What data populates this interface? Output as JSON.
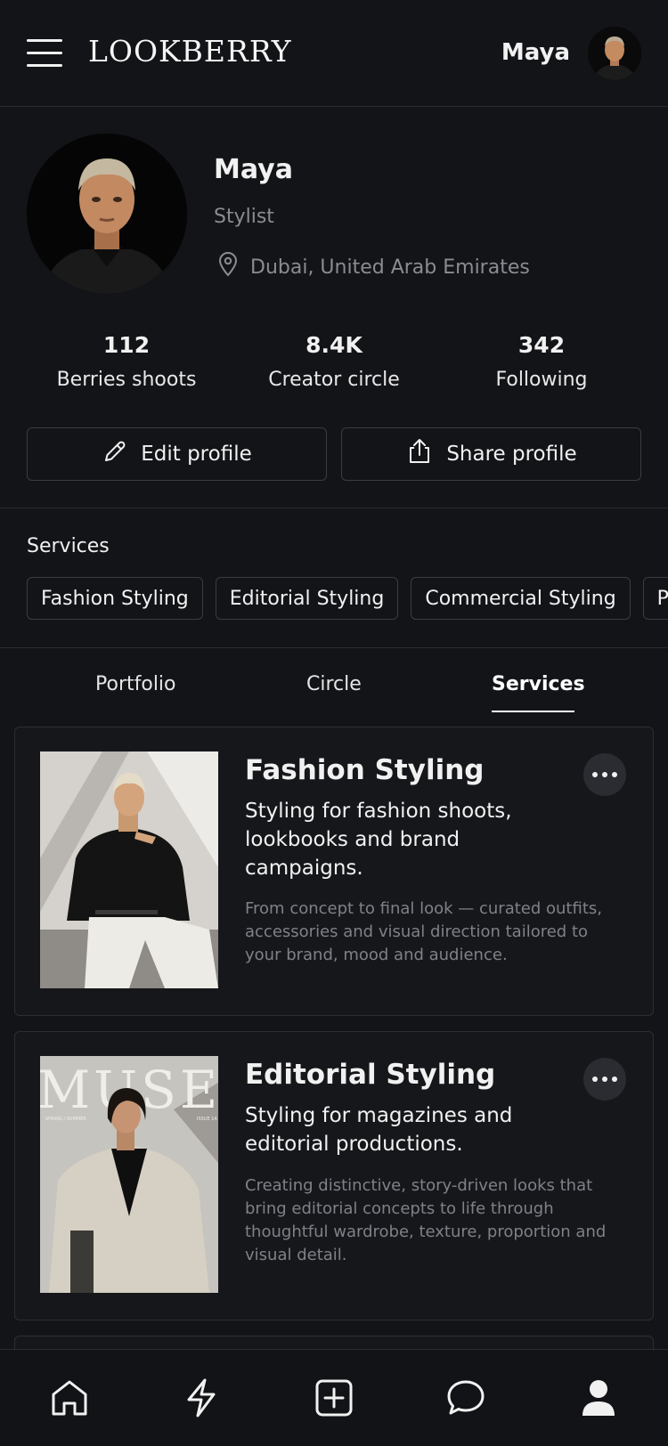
{
  "header": {
    "menu_icon": "hamburger-icon",
    "logo": "LOOKBERRY",
    "user_name": "Maya"
  },
  "profile": {
    "name": "Maya",
    "role": "Stylist",
    "location": "Dubai, United Arab Emirates",
    "location_icon": "map-pin-icon"
  },
  "stats": [
    {
      "value": "112",
      "label": "Berries shoots"
    },
    {
      "value": "8.4K",
      "label": "Creator circle"
    },
    {
      "value": "342",
      "label": "Following"
    }
  ],
  "actions": {
    "edit_label": "Edit profile",
    "share_label": "Share profile"
  },
  "services_section": {
    "title": "Services",
    "chips": [
      "Fashion Styling",
      "Editorial Styling",
      "Commercial Styling",
      "P"
    ]
  },
  "tabs": [
    {
      "label": "Portfolio",
      "active": false
    },
    {
      "label": "Circle",
      "active": false
    },
    {
      "label": "Services",
      "active": true
    }
  ],
  "cards": [
    {
      "title": "Fashion Styling",
      "subtitle": "Styling for fashion shoots, lookbooks and brand campaigns.",
      "description": "From concept to final look — curated outfits, accessories and visual direction tailored to your brand, mood and audience."
    },
    {
      "title": "Editorial Styling",
      "subtitle": "Styling for magazines and editorial productions.",
      "description": "Creating distinctive, story-driven looks that bring editorial concepts to life through thoughtful wardrobe, texture, proportion and visual detail.",
      "cover_text": "MUSE",
      "cover_small_left": "SPRING / SUMMER",
      "cover_small_right": "ISSUE 14"
    }
  ],
  "bottom_nav": [
    "home-icon",
    "lightning-icon",
    "add-square-icon",
    "chat-icon",
    "profile-icon"
  ],
  "colors": {
    "background": "#131418",
    "card": "#16171b",
    "border": "#2c2e33",
    "muted_text": "#8a8c92"
  }
}
